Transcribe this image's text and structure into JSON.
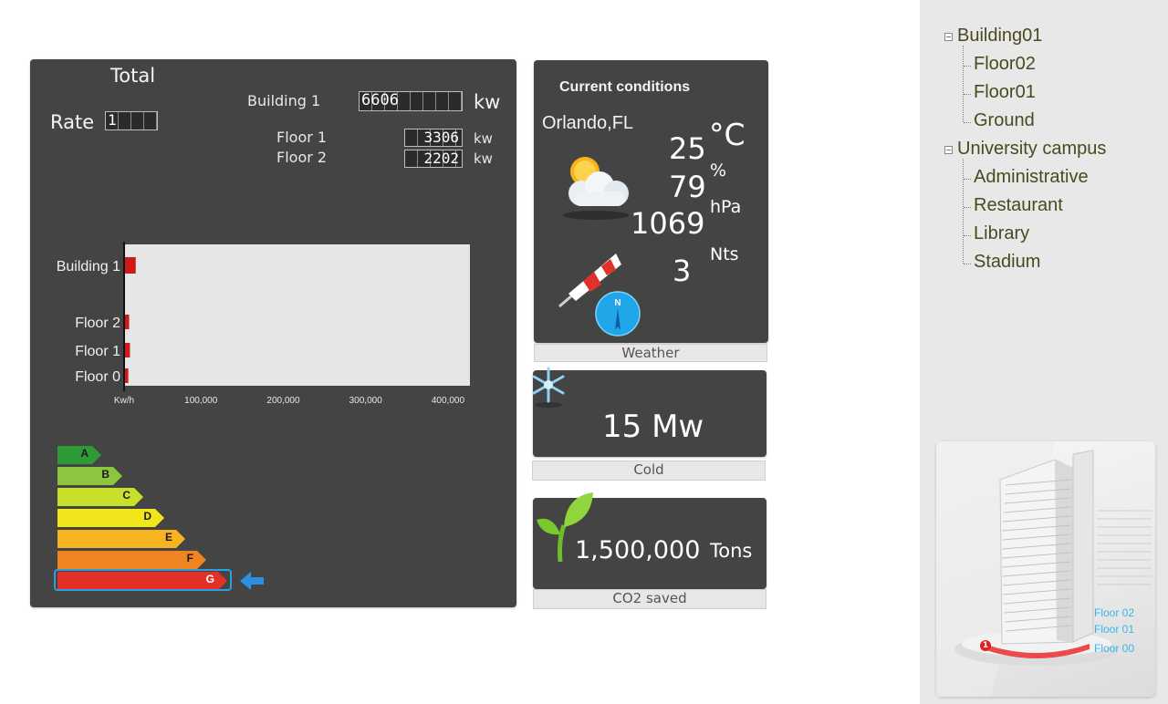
{
  "total": {
    "title": "Total",
    "rate_label": "Rate",
    "rate_value": "1",
    "building_label": "Building 1",
    "building_value": "6606",
    "building_unit": "kw",
    "floors": [
      {
        "label": "Floor 1",
        "value": "3306",
        "unit": "kw"
      },
      {
        "label": "Floor 2",
        "value": "2202",
        "unit": "kw"
      }
    ]
  },
  "chart_data": {
    "type": "bar",
    "orientation": "horizontal",
    "categories": [
      "Building 1",
      "Floor 2",
      "Floor 1",
      "Floor 0"
    ],
    "values": [
      13000,
      5000,
      6000,
      4000
    ],
    "xlabel": "Kw/h",
    "xticks": [
      "100,000",
      "200,000",
      "300,000",
      "400,000"
    ],
    "xlim": [
      0,
      420000
    ],
    "color": "#cc1a1a"
  },
  "energy_rating": {
    "grades": [
      "A",
      "B",
      "C",
      "D",
      "E",
      "F",
      "G"
    ],
    "colors": [
      "#2f9b37",
      "#8cc63f",
      "#c9e02a",
      "#f3e51b",
      "#f8b320",
      "#f08422",
      "#e5302a"
    ],
    "selected": "G"
  },
  "weather": {
    "title": "Current conditions",
    "location": "Orlando,FL",
    "temperature": "25",
    "temperature_unit": "°C",
    "humidity": "79",
    "humidity_unit": "%",
    "pressure": "1069",
    "pressure_unit": "hPa",
    "wind": "3",
    "wind_unit": "Nts",
    "compass_label": "N",
    "caption": "Weather"
  },
  "cold": {
    "value": "15 Mw",
    "caption": "Cold"
  },
  "co2": {
    "value": "1,500,000",
    "unit": "Tons",
    "caption": "CO2  saved"
  },
  "tree": [
    {
      "label": "Building01",
      "children": [
        "Floor02",
        "Floor01",
        "Ground"
      ]
    },
    {
      "label": "University campus",
      "children": [
        "Administrative",
        "Restaurant",
        "Library",
        "Stadium"
      ]
    }
  ],
  "building_view": {
    "floor_labels": [
      "Floor 02",
      "Floor 01",
      "Floor 00"
    ],
    "marker": "1",
    "accent": "#38b6e8"
  }
}
